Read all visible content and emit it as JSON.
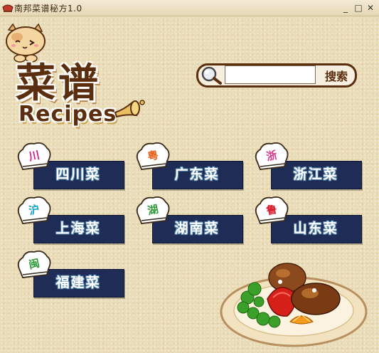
{
  "window": {
    "title": "南邦菜谱秘方1.0",
    "controls": {
      "minimize": "_",
      "maximize": "□",
      "close": "✕"
    }
  },
  "logo": {
    "chinese": "菜谱",
    "english": "Recipes"
  },
  "search": {
    "value": "",
    "button_label": "搜索",
    "icon": "magnifier-icon"
  },
  "categories": [
    {
      "label": "四川菜",
      "badge": "川",
      "badge_color": "#d81b8a"
    },
    {
      "label": "广东菜",
      "badge": "粤",
      "badge_color": "#e8601a"
    },
    {
      "label": "浙江菜",
      "badge": "浙",
      "badge_color": "#d63a8a"
    },
    {
      "label": "上海菜",
      "badge": "沪",
      "badge_color": "#1aa3c8"
    },
    {
      "label": "湖南菜",
      "badge": "湖",
      "badge_color": "#2f9a3a"
    },
    {
      "label": "山东菜",
      "badge": "鲁",
      "badge_color": "#d81b2a"
    },
    {
      "label": "福建菜",
      "badge": "闽",
      "badge_color": "#2f9a3a"
    }
  ],
  "colors": {
    "background": "#eadcb7",
    "plate": "#1f2c55",
    "logo_brown": "#5a2e0e"
  }
}
